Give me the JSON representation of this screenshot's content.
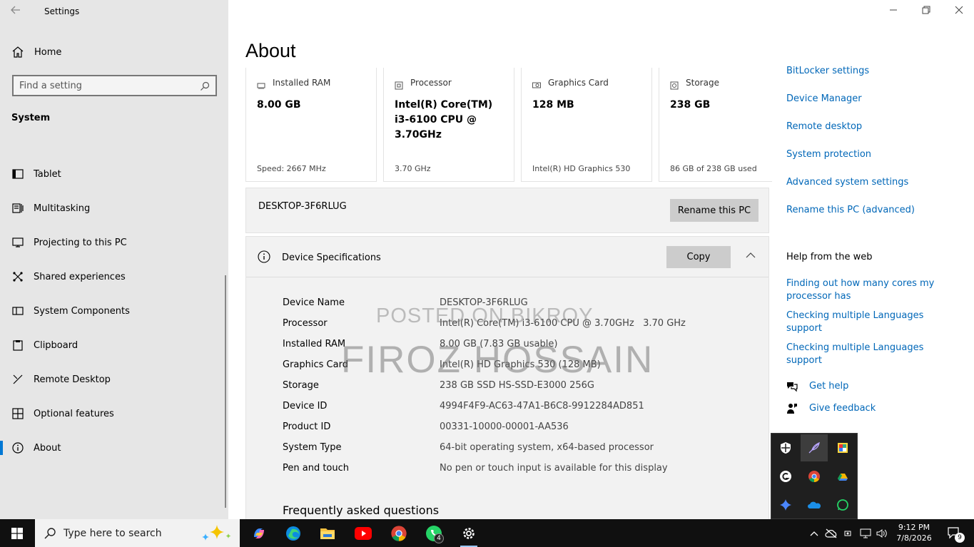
{
  "window": {
    "title": "Settings"
  },
  "sidebar": {
    "home_label": "Home",
    "search_placeholder": "Find a setting",
    "section": "System",
    "items": [
      {
        "label": "Tablet",
        "icon": "tablet-icon"
      },
      {
        "label": "Multitasking",
        "icon": "multitasking-icon"
      },
      {
        "label": "Projecting to this PC",
        "icon": "projecting-icon"
      },
      {
        "label": "Shared experiences",
        "icon": "shared-experiences-icon"
      },
      {
        "label": "System Components",
        "icon": "system-components-icon"
      },
      {
        "label": "Clipboard",
        "icon": "clipboard-icon"
      },
      {
        "label": "Remote Desktop",
        "icon": "remote-desktop-icon"
      },
      {
        "label": "Optional features",
        "icon": "optional-features-icon"
      },
      {
        "label": "About",
        "icon": "info-icon",
        "active": true
      }
    ]
  },
  "page": {
    "title": "About"
  },
  "cards": [
    {
      "title": "Installed RAM",
      "value": "8.00 GB",
      "sub": "Speed: 2667 MHz",
      "icon": "ram-icon"
    },
    {
      "title": "Processor",
      "value": "Intel(R) Core(TM) i3-6100 CPU @ 3.70GHz",
      "sub": "3.70 GHz",
      "icon": "processor-icon"
    },
    {
      "title": "Graphics Card",
      "value": "128 MB",
      "sub": "Intel(R) HD Graphics 530",
      "icon": "graphics-card-icon"
    },
    {
      "title": "Storage",
      "value": "238 GB",
      "sub": "86 GB of 238 GB used",
      "icon": "storage-icon"
    }
  ],
  "pc_name": {
    "name": "DESKTOP-3F6RLUG",
    "rename_button": "Rename this PC"
  },
  "specs": {
    "title": "Device Specifications",
    "copy_button": "Copy",
    "rows": [
      {
        "key": "Device Name",
        "value": "DESKTOP-3F6RLUG"
      },
      {
        "key": "Processor",
        "value": "Intel(R) Core(TM) i3-6100 CPU @ 3.70GHz   3.70 GHz"
      },
      {
        "key": "Installed RAM",
        "value": "8.00 GB (7.83 GB usable)"
      },
      {
        "key": "Graphics Card",
        "value": "Intel(R) HD Graphics 530 (128 MB)"
      },
      {
        "key": "Storage",
        "value": "238 GB SSD HS-SSD-E3000 256G"
      },
      {
        "key": "Device ID",
        "value": "4994F4F9-AC63-47A1-B6C8-9912284AD851"
      },
      {
        "key": "Product ID",
        "value": "00331-10000-00001-AA536"
      },
      {
        "key": "System Type",
        "value": "64-bit operating system, x64-based processor"
      },
      {
        "key": "Pen and touch",
        "value": "No pen or touch input is available for this display"
      }
    ],
    "faq_title": "Frequently asked questions"
  },
  "watermark": {
    "line1": "POSTED ON BIKROY",
    "line2": "FIROZ HOSSAIN"
  },
  "related_links": [
    "BitLocker settings",
    "Device Manager",
    "Remote desktop",
    "System protection",
    "Advanced system settings",
    "Rename this PC (advanced)"
  ],
  "help": {
    "title": "Help from the web",
    "links": [
      "Finding out how many cores my processor has",
      "Checking multiple Languages support",
      "Checking multiple Languages support"
    ],
    "get_help": "Get help",
    "give_feedback": "Give feedback"
  },
  "taskbar": {
    "search_placeholder": "Type here to search",
    "apps": [
      "copilot-icon",
      "edge-icon",
      "file-explorer-icon",
      "youtube-icon",
      "chrome-icon",
      "whatsapp-icon",
      "settings-icon"
    ],
    "whatsapp_badge": "4",
    "time": "9:12 PM",
    "date": "7/8/2026",
    "notifications": "9"
  },
  "tray_icons": [
    "defender-icon",
    "feather-icon",
    "paint-icon",
    "grammarly-icon",
    "chrome-icon",
    "drive-icon",
    "gemini-icon",
    "onedrive-icon",
    "whatsapp-icon"
  ]
}
